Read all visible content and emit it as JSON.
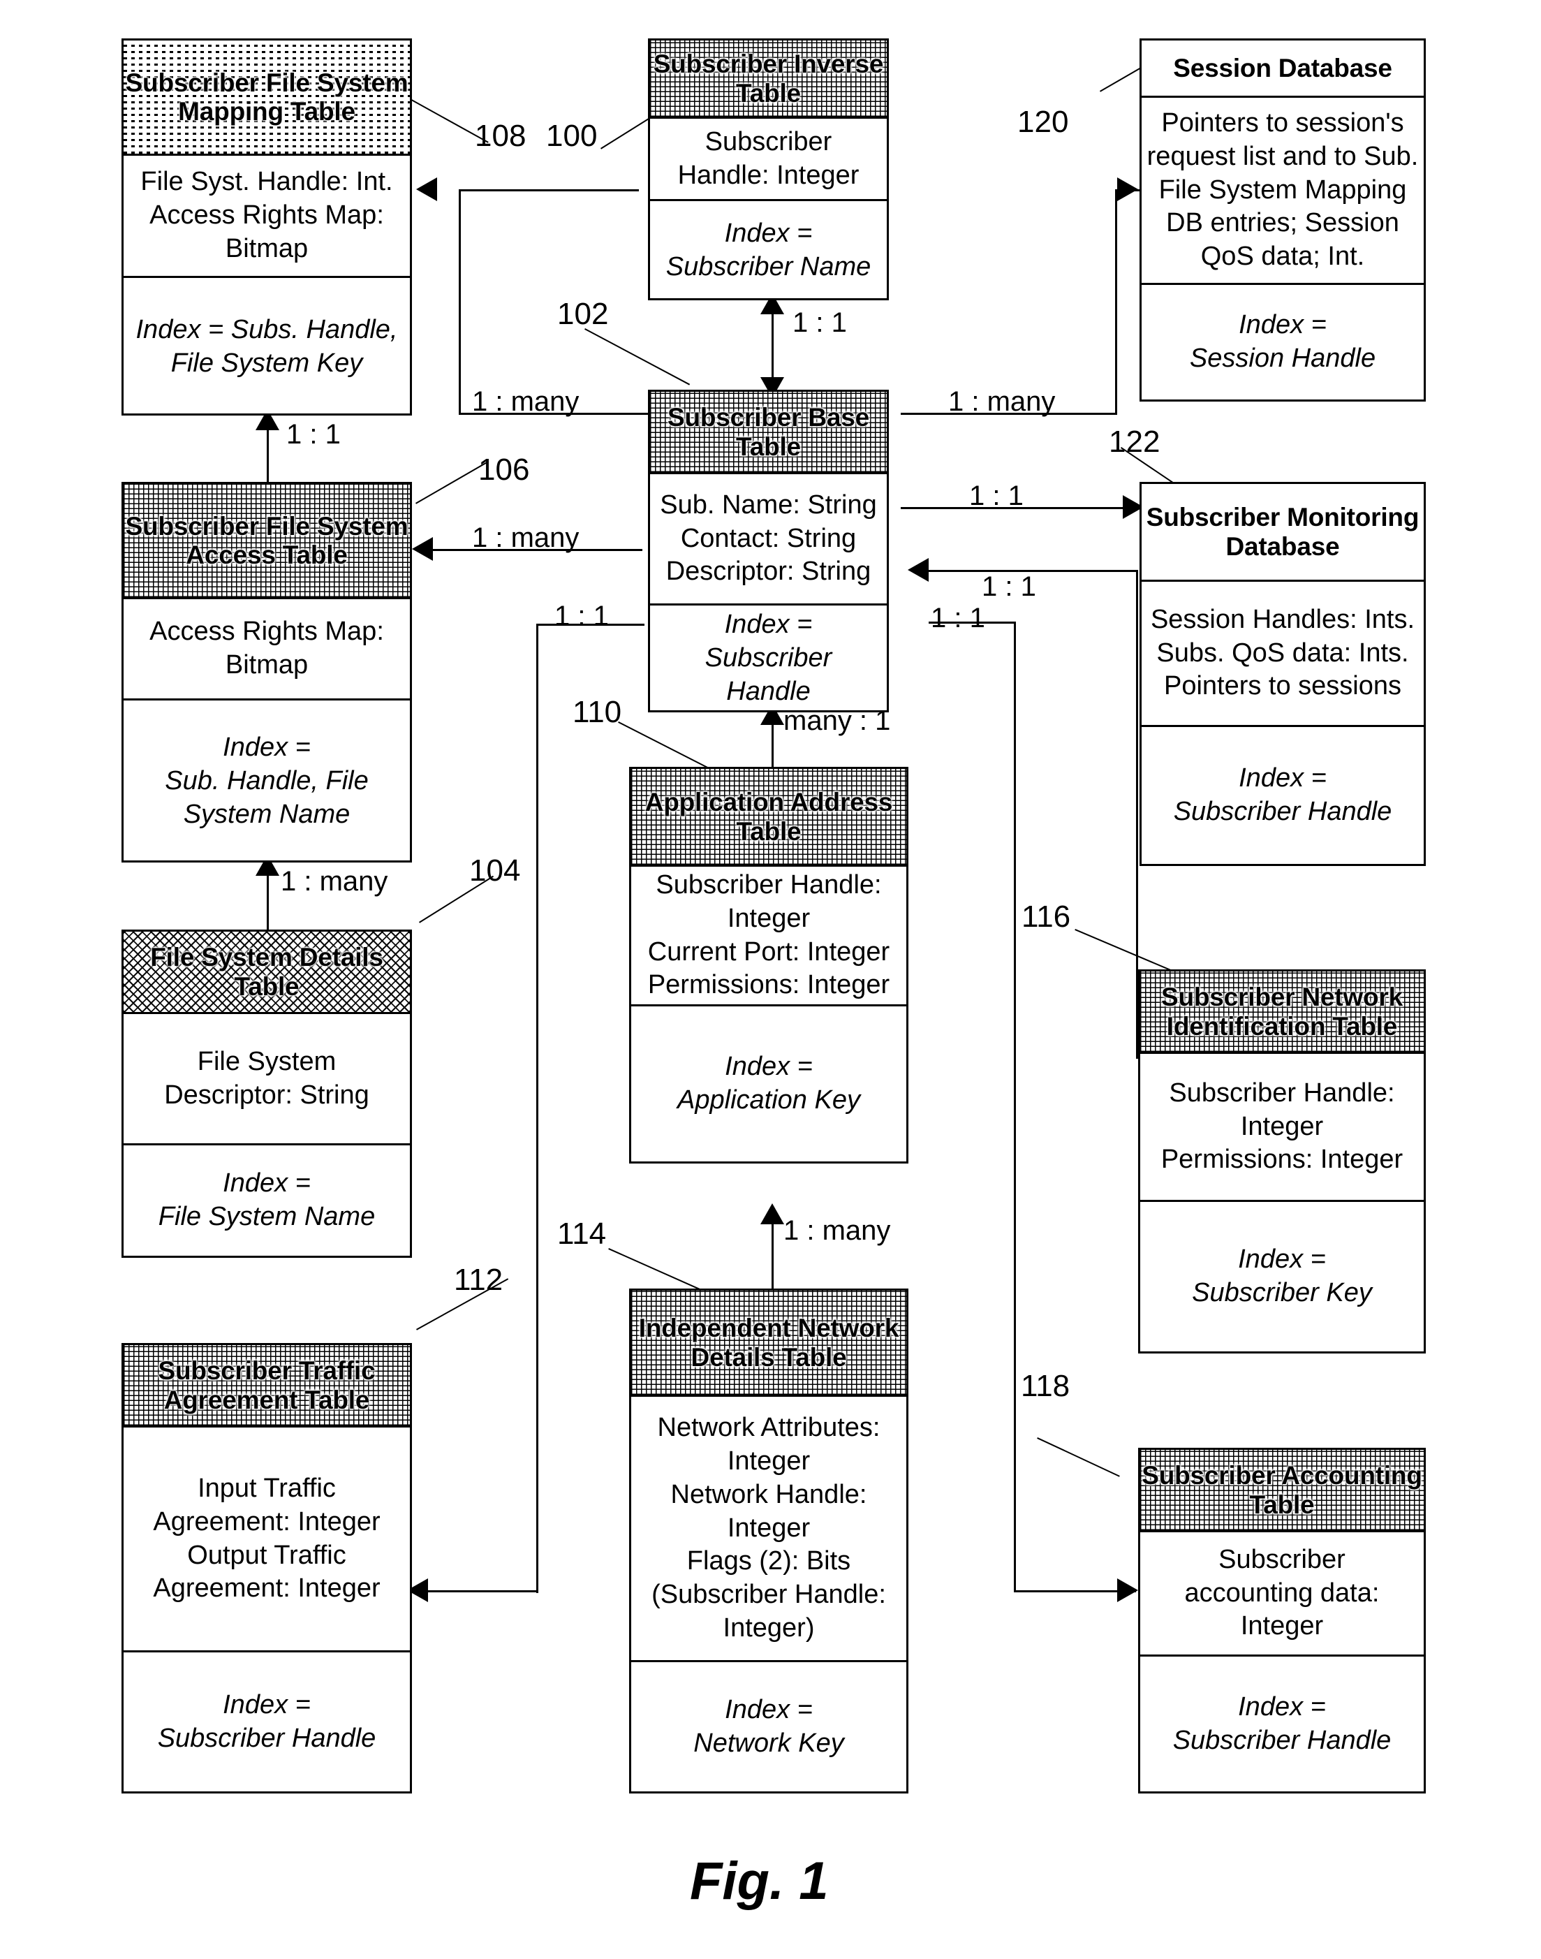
{
  "figure": {
    "caption": "Fig. 1"
  },
  "entities": [
    {
      "id": "sub-file-system-mapping-table",
      "title": "Subscriber File System Mapping Table",
      "attributes": "File Syst. Handle: Int.\nAccess Rights Map: Bitmap",
      "index": "Index = Subs. Handle,\nFile System Key",
      "ref": "108"
    },
    {
      "id": "subscriber-inverse-table",
      "title": "Subscriber Inverse Table",
      "attributes": "Subscriber\nHandle: Integer",
      "index": "Index =\nSubscriber Name",
      "ref": "100"
    },
    {
      "id": "session-database",
      "title": "Session Database",
      "attributes": "Pointers to session's request list and to Sub. File System Mapping DB entries; Session QoS data; Int.",
      "index": "Index =\nSession Handle",
      "ref": "120"
    },
    {
      "id": "subscriber-base-table",
      "title": "Subscriber Base Table",
      "attributes": "Sub. Name: String\nContact: String\nDescriptor: String",
      "index": "Index =\nSubscriber\nHandle",
      "ref": "102"
    },
    {
      "id": "sub-file-system-access-table",
      "title": "Subscriber File System Access Table",
      "attributes": "Access Rights Map: Bitmap",
      "index": "Index =\nSub. Handle, File System Name",
      "ref": "106"
    },
    {
      "id": "subscriber-monitoring-database",
      "title": "Subscriber Monitoring Database",
      "attributes": "Session Handles: Ints.\nSubs. QoS data: Ints.\nPointers to sessions",
      "index": "Index =\nSubscriber Handle",
      "ref": "122"
    },
    {
      "id": "file-system-details-table",
      "title": "File System Details Table",
      "attributes": "File System\nDescriptor: String",
      "index": "Index =\nFile System Name",
      "ref": "104"
    },
    {
      "id": "application-address-table",
      "title": "Application Address Table",
      "attributes": "Subscriber Handle: Integer\nCurrent Port: Integer\nPermissions: Integer",
      "index": "Index =\nApplication Key",
      "ref": "110"
    },
    {
      "id": "subscriber-network-identification-table",
      "title": "Subscriber Network Identification Table",
      "attributes": "Subscriber Handle: Integer\nPermissions: Integer",
      "index": "Index =\nSubscriber Key",
      "ref": "116"
    },
    {
      "id": "subscriber-traffic-agreement-table",
      "title": "Subscriber Traffic Agreement Table",
      "attributes": "Input Traffic Agreement:  Integer\nOutput Traffic Agreement: Integer",
      "index": "Index =\nSubscriber Handle",
      "ref": "112"
    },
    {
      "id": "independent-network-details-table",
      "title": "Independent Network Details Table",
      "attributes": "Network Attributes: Integer\nNetwork Handle: Integer\nFlags (2): Bits\n(Subscriber Handle: Integer)",
      "index": "Index =\nNetwork Key",
      "ref": "114"
    },
    {
      "id": "subscriber-accounting-table",
      "title": "Subscriber Accounting Table",
      "attributes": "Subscriber\naccounting data:\nInteger",
      "index": "Index =\nSubscriber Handle",
      "ref": "118"
    }
  ],
  "cardinalities": {
    "mapping_to_access": "1 : 1",
    "inverse_to_base": "1 : 1",
    "base_to_mapping": "1 : many",
    "base_to_session": "1 : many",
    "base_to_access": "1 : many",
    "base_to_monitoring": "1 : 1",
    "netid_to_base": "1 : 1",
    "accounting_to_base": "1 : 1",
    "access_to_details": "1 : many",
    "base_to_apptable": "many : 1",
    "apptable_to_network": "1 : many",
    "base_to_traffic": "1 : 1"
  },
  "reference_numerals": [
    "100",
    "102",
    "104",
    "106",
    "108",
    "110",
    "112",
    "114",
    "116",
    "118",
    "120",
    "122"
  ]
}
